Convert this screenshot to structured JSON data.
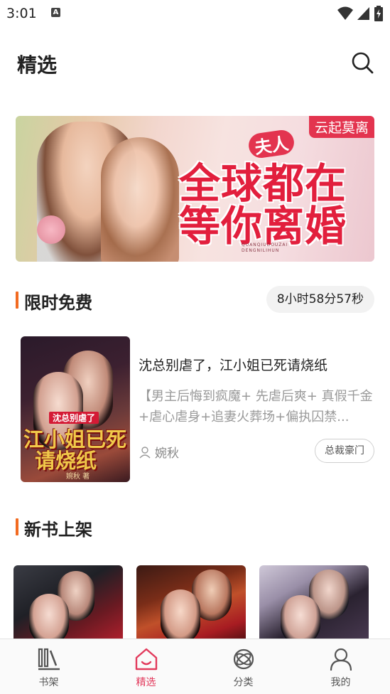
{
  "status_bar": {
    "time": "3:01",
    "notification_letter": "A"
  },
  "header": {
    "title": "精选",
    "search_icon": "search-icon"
  },
  "banner": {
    "author_tag": "云起莫离",
    "title_small": "夫人",
    "title_line1": "全球都在",
    "title_line2": "等你离婚",
    "pinyin": "QUANQIUDOUZAI DENGNILIHUN",
    "colors": {
      "title": "#e21f3d",
      "tag_bg": "#e3344f"
    }
  },
  "limited_free": {
    "heading": "限时免费",
    "timer": "8小时58分57秒",
    "book": {
      "cover_subtitle": "沈总别虐了",
      "cover_title_line1": "江小姐已死",
      "cover_title_line2": "请烧纸",
      "cover_author": "婉秋 著",
      "title": "沈总别虐了，江小姐已死请烧纸",
      "description": "【男主后悔到疯魔+ 先虐后爽+ 真假千金+虐心虐身+追妻火葬场+偏执囚禁...",
      "author": "婉秋",
      "tag": "总裁豪门"
    }
  },
  "new_books": {
    "heading": "新书上架"
  },
  "tabbar": {
    "tabs": [
      {
        "label": "书架",
        "icon": "bookshelf-icon"
      },
      {
        "label": "精选",
        "icon": "home-icon"
      },
      {
        "label": "分类",
        "icon": "category-icon"
      },
      {
        "label": "我的",
        "icon": "profile-icon"
      }
    ],
    "active_color": "#e23a5c"
  },
  "accent_color": "#f26b21"
}
